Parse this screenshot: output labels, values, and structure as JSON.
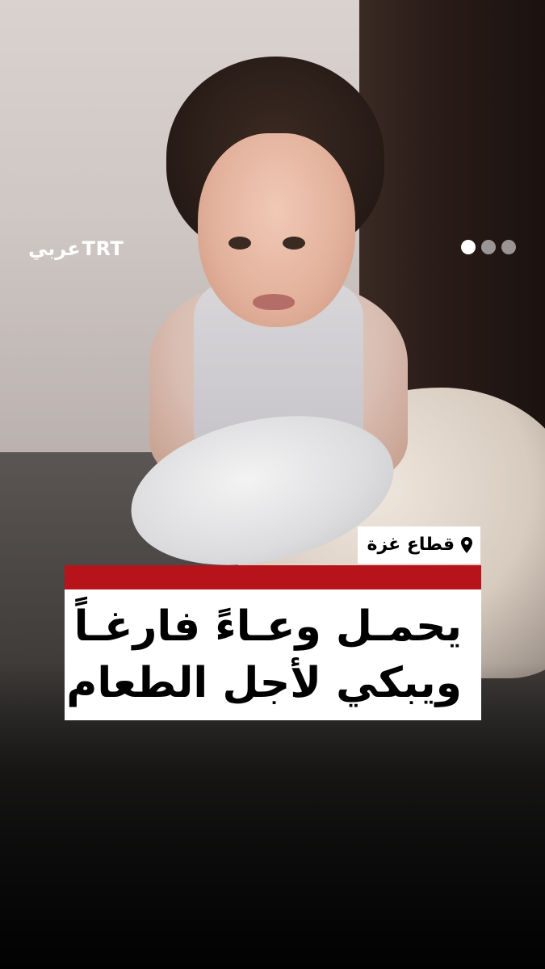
{
  "brand": {
    "latin": "TRT",
    "arabic": "عربي"
  },
  "carousel": {
    "dots": 3,
    "active_index": 0
  },
  "location": {
    "icon": "location-pin-icon",
    "text": "قطاع غزة"
  },
  "headline": {
    "line1": "يحمـل وعـاءً فارغـاً",
    "line2": "ويبكي لأجل الطعام"
  },
  "colors": {
    "accent_red": "#b7131a",
    "label_bg": "#ffffff",
    "text": "#000000"
  }
}
